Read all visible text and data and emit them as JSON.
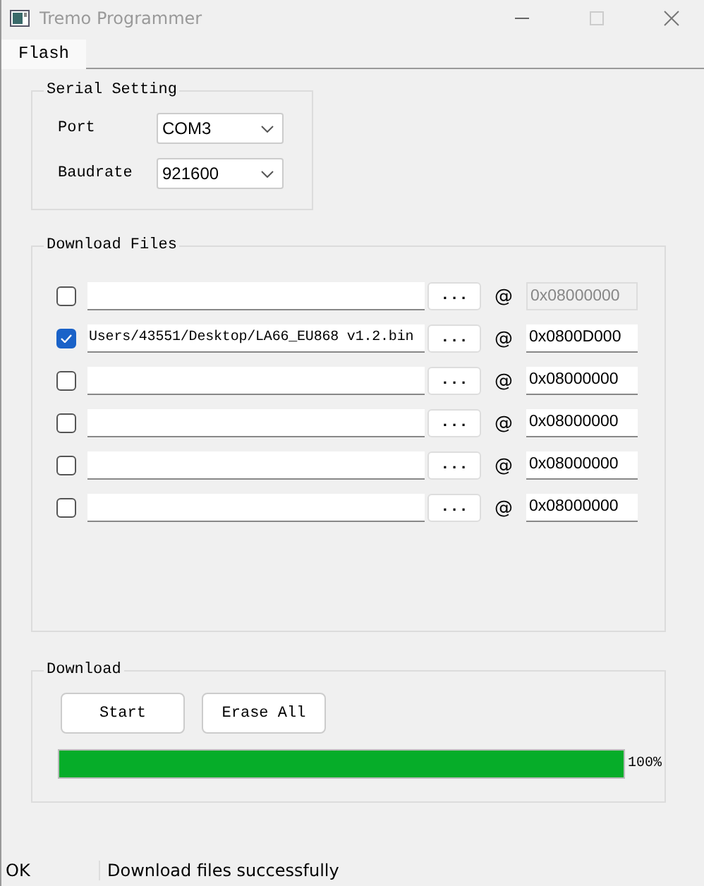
{
  "window": {
    "title": "Tremo Programmer"
  },
  "tabs": [
    {
      "label": "Flash",
      "selected": true
    }
  ],
  "serial_setting": {
    "title": "Serial Setting",
    "fields": [
      {
        "label": "Port",
        "value": "COM3"
      },
      {
        "label": "Baudrate",
        "value": "921600"
      }
    ]
  },
  "download_files": {
    "title": "Download Files",
    "rows": [
      {
        "checked": false,
        "path": "",
        "browse": "...",
        "at": "@",
        "address": "0x08000000",
        "address_disabled": true
      },
      {
        "checked": true,
        "path": "Users/43551/Desktop/LA66_EU868 v1.2.bin",
        "browse": "...",
        "at": "@",
        "address": "0x0800D000",
        "address_disabled": false
      },
      {
        "checked": false,
        "path": "",
        "browse": "...",
        "at": "@",
        "address": "0x08000000",
        "address_disabled": false
      },
      {
        "checked": false,
        "path": "",
        "browse": "...",
        "at": "@",
        "address": "0x08000000",
        "address_disabled": false
      },
      {
        "checked": false,
        "path": "",
        "browse": "...",
        "at": "@",
        "address": "0x08000000",
        "address_disabled": false
      },
      {
        "checked": false,
        "path": "",
        "browse": "...",
        "at": "@",
        "address": "0x08000000",
        "address_disabled": false
      }
    ]
  },
  "download": {
    "title": "Download",
    "buttons": [
      "Start",
      "Erase All"
    ],
    "progress": {
      "level": 1,
      "reading": "100%"
    }
  },
  "status_bar": {
    "state": "OK",
    "message": "Download files successfully"
  }
}
